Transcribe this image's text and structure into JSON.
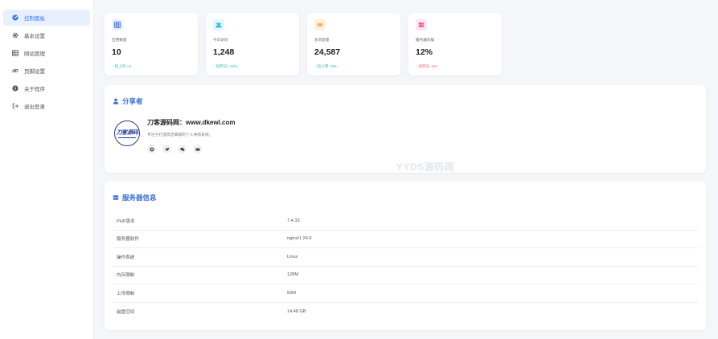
{
  "sidebar": {
    "items": [
      {
        "label": "控制面板",
        "icon": "dashboard-icon",
        "active": true
      },
      {
        "label": "基本设置",
        "icon": "gear-icon",
        "active": false
      },
      {
        "label": "网站管理",
        "icon": "grid-icon",
        "active": false
      },
      {
        "label": "页脚设置",
        "icon": "link-icon",
        "active": false
      },
      {
        "label": "关于程序",
        "icon": "info-icon",
        "active": false
      },
      {
        "label": "退出登录",
        "icon": "logout-icon",
        "active": false
      }
    ]
  },
  "stats": [
    {
      "label": "应用数量",
      "value": "10",
      "trend": "↑ 较上月 +2",
      "trend_color": "#2dbd9b",
      "badge_bg": "#e6efff",
      "badge_fg": "#3a6fd8",
      "icon": "table-icon"
    },
    {
      "label": "今日访问",
      "value": "1,248",
      "trend": "↑ 较昨日 +12%",
      "trend_color": "#2dbd9b",
      "badge_bg": "#e2f6fb",
      "badge_fg": "#24b3d8",
      "icon": "users-icon"
    },
    {
      "label": "总浏览量",
      "value": "24,587",
      "trend": "↑ 较上周 +8%",
      "trend_color": "#2dbd9b",
      "badge_bg": "#fff1df",
      "badge_fg": "#f59a23",
      "icon": "eye-icon"
    },
    {
      "label": "服务器负载",
      "value": "12%",
      "trend": "↓ 较昨日 -3%",
      "trend_color": "#ef5b7a",
      "badge_bg": "#fde6ef",
      "badge_fg": "#ec4f84",
      "icon": "server-icon"
    }
  ],
  "share": {
    "title": "分享者",
    "logo_text": "刀客源码",
    "site_name": "刀客源码网：www.dkewl.com",
    "description": "专注于打造简洁美观的个人导航系统。",
    "socials": [
      "github-icon",
      "twitter-icon",
      "wechat-icon",
      "email-icon"
    ],
    "watermark": "YYDS源码网"
  },
  "server": {
    "title": "服务器信息",
    "rows": [
      {
        "key": "PHP版本",
        "value": "7.4.33"
      },
      {
        "key": "服务器软件",
        "value": "nginx/1.24.0"
      },
      {
        "key": "操作系统",
        "value": "Linux"
      },
      {
        "key": "内存限制",
        "value": "128M"
      },
      {
        "key": "上传限制",
        "value": "50M"
      },
      {
        "key": "磁盘空间",
        "value": "14.48 GB"
      }
    ]
  },
  "colors": {
    "accent": "#3a6fd8",
    "sidebar_active_bg": "#e9f0fd"
  }
}
